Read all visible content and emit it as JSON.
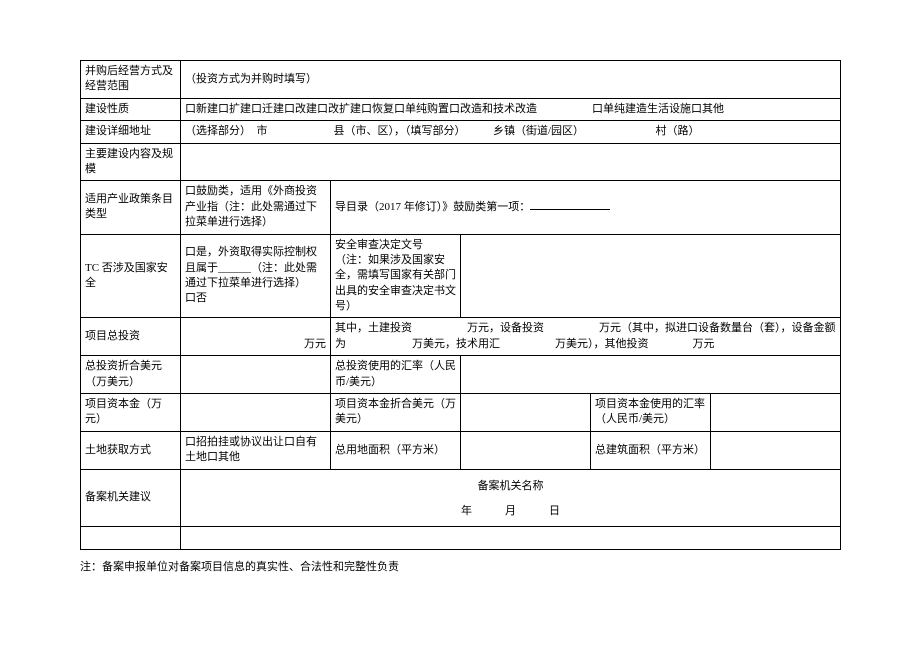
{
  "rows": {
    "r1": {
      "label": "并购后经营方式及经营范围",
      "content": "（投资方式为并购时填写）"
    },
    "r2": {
      "label": "建设性质",
      "content": "口新建口扩建口迁建口改建口改扩建口恢复口单纯购置口改造和技术改造　　　　　口单纯建造生活设施口其他"
    },
    "r3": {
      "label": "建设详细地址",
      "content": "（选择部分）　市　　　　　　县（市、区），（填写部分）　　　乡镇（街道/园区）　　　　　　　村（路）"
    },
    "r4": {
      "label": "主要建设内容及规模",
      "content": ""
    },
    "r5": {
      "label": "适用产业政策条目类型",
      "c1": "口鼓励类，适用《外商投资产业指（注：此处需通过下拉菜单进行选择）",
      "c2": "导目录（2017 年修订）》鼓励类第一项：",
      "c3": ""
    },
    "r6": {
      "label": "TC 否涉及国家安全",
      "c1": "口是，外资取得实际控制权且属于______（注：此处需通过下拉菜单进行选择）\n口否",
      "c2": "安全审查决定文号\n（注：如果涉及国家安全，需填写国家有关部门出具的安全审查决定书文号）",
      "c3": ""
    },
    "r7": {
      "label": "项目总投资",
      "c1": "万元",
      "c2": "其中，土建投资　　　　　万元，设备投资　　　　　万元（其中，拟进口设备数量台（套），设备金额为　　　　　　万美元，技术用汇　　　　　万美元），其他投资　　　　万元"
    },
    "r8": {
      "label": "总投资折合美元（万美元）",
      "c1": "",
      "c2label": "总投资使用的汇率（人民币/美元）",
      "c2": ""
    },
    "r9": {
      "label": "项目资本金（万元）",
      "c1": "",
      "c2label": "项目资本金折合美元（万美元）",
      "c2": "",
      "c3label": "项目资本金使用的汇率（人民币/美元）",
      "c3": ""
    },
    "r10": {
      "label": "土地获取方式",
      "c1": "口招拍挂或协议出让口自有土地口其他",
      "c2label": "总用地面积（平方米）",
      "c2": "",
      "c3label": "总建筑面积（平方米）",
      "c3": ""
    },
    "r11": {
      "label": "备案机关建议",
      "title": "备案机关名称",
      "date": "年　　　月　　　日"
    }
  },
  "footnote": "注：备案申报单位对备案项目信息的真实性、合法性和完整性负责"
}
